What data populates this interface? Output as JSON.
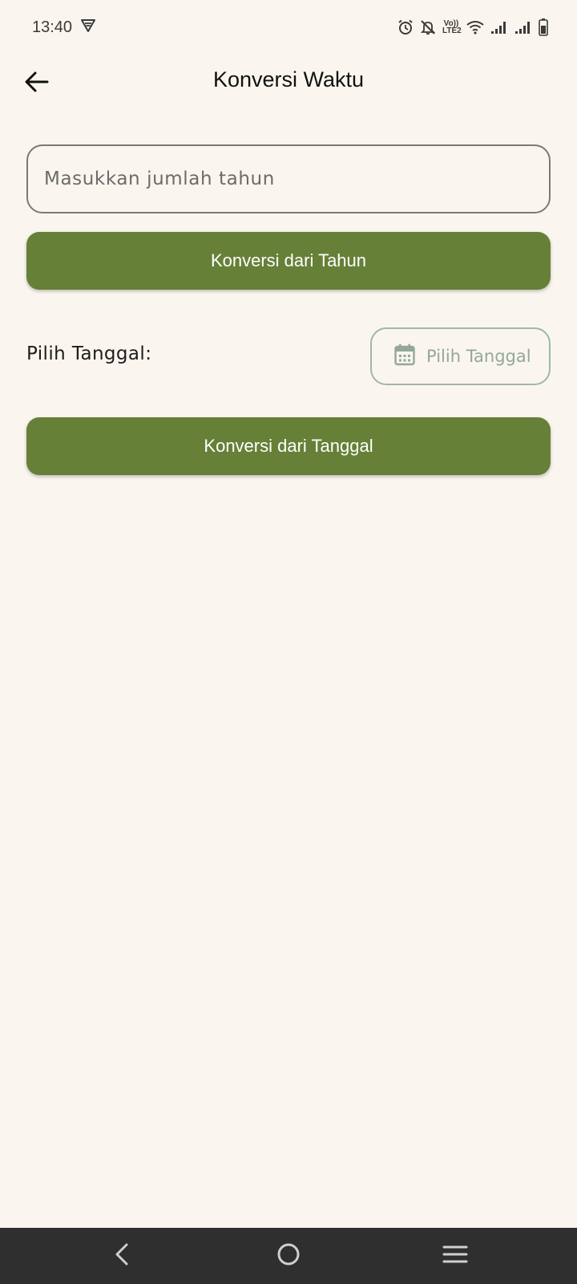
{
  "status_bar": {
    "time": "13:40",
    "volte_top": "Vo))",
    "volte_bottom": "LTE2",
    "icons": [
      "vpn-shield-icon",
      "alarm-icon",
      "notifications-off-icon",
      "volte-icon",
      "wifi-icon",
      "signal-icon",
      "signal-icon",
      "battery-icon"
    ]
  },
  "app_bar": {
    "back_icon": "arrow-left-icon",
    "title": "Konversi Waktu"
  },
  "year_input": {
    "value": "",
    "placeholder": "Masukkan jumlah tahun"
  },
  "convert_year_button": {
    "label": "Konversi dari Tahun"
  },
  "date_section": {
    "label": "Pilih Tanggal:",
    "picker_icon": "calendar-icon",
    "picker_label": "Pilih Tanggal"
  },
  "convert_date_button": {
    "label": "Konversi dari Tanggal"
  },
  "nav_bar": {
    "icons": [
      "nav-back-icon",
      "nav-home-icon",
      "nav-menu-icon"
    ]
  },
  "colors": {
    "background": "#FAF6EF",
    "primary_button": "#668037",
    "picker_outline": "#9FB7A8",
    "nav_bar": "#2F2F2F"
  }
}
